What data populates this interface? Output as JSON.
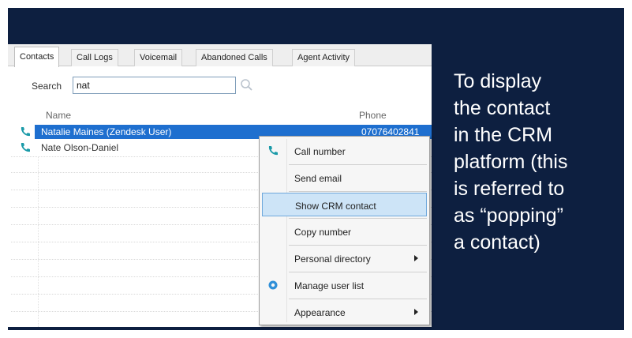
{
  "tabs": [
    "Contacts",
    "Call Logs",
    "Voicemail",
    "Abandoned Calls",
    "Agent Activity"
  ],
  "search": {
    "label": "Search",
    "value": "nat"
  },
  "columns": {
    "name": "Name",
    "phone": "Phone"
  },
  "contacts": [
    {
      "name": "Natalie Maines (Zendesk User)",
      "phone": "07076402841",
      "selected": true
    },
    {
      "name": "Nate Olson-Daniel",
      "phone": "",
      "selected": false
    }
  ],
  "context_menu": {
    "items": [
      {
        "label": "Call number",
        "icon": "phone-icon"
      },
      {
        "label": "Send email",
        "icon": ""
      },
      {
        "label": "Show CRM contact",
        "icon": "",
        "highlighted": true
      },
      {
        "label": "Copy number",
        "icon": ""
      },
      {
        "label": "Personal directory",
        "icon": "",
        "submenu": true
      },
      {
        "label": "Manage user list",
        "icon": "gear-icon"
      },
      {
        "label": "Appearance",
        "icon": "",
        "submenu": true
      }
    ]
  },
  "caption": {
    "lines": [
      "To display",
      "the contact",
      "in the CRM",
      "platform (this",
      "is referred to",
      "as “popping”",
      "a contact)"
    ]
  },
  "colors": {
    "frame_background": "#0d1f40",
    "selection_blue": "#1e6fcf",
    "menu_highlight": "#cde4f7",
    "phone_icon_teal": "#1a9aa8"
  }
}
